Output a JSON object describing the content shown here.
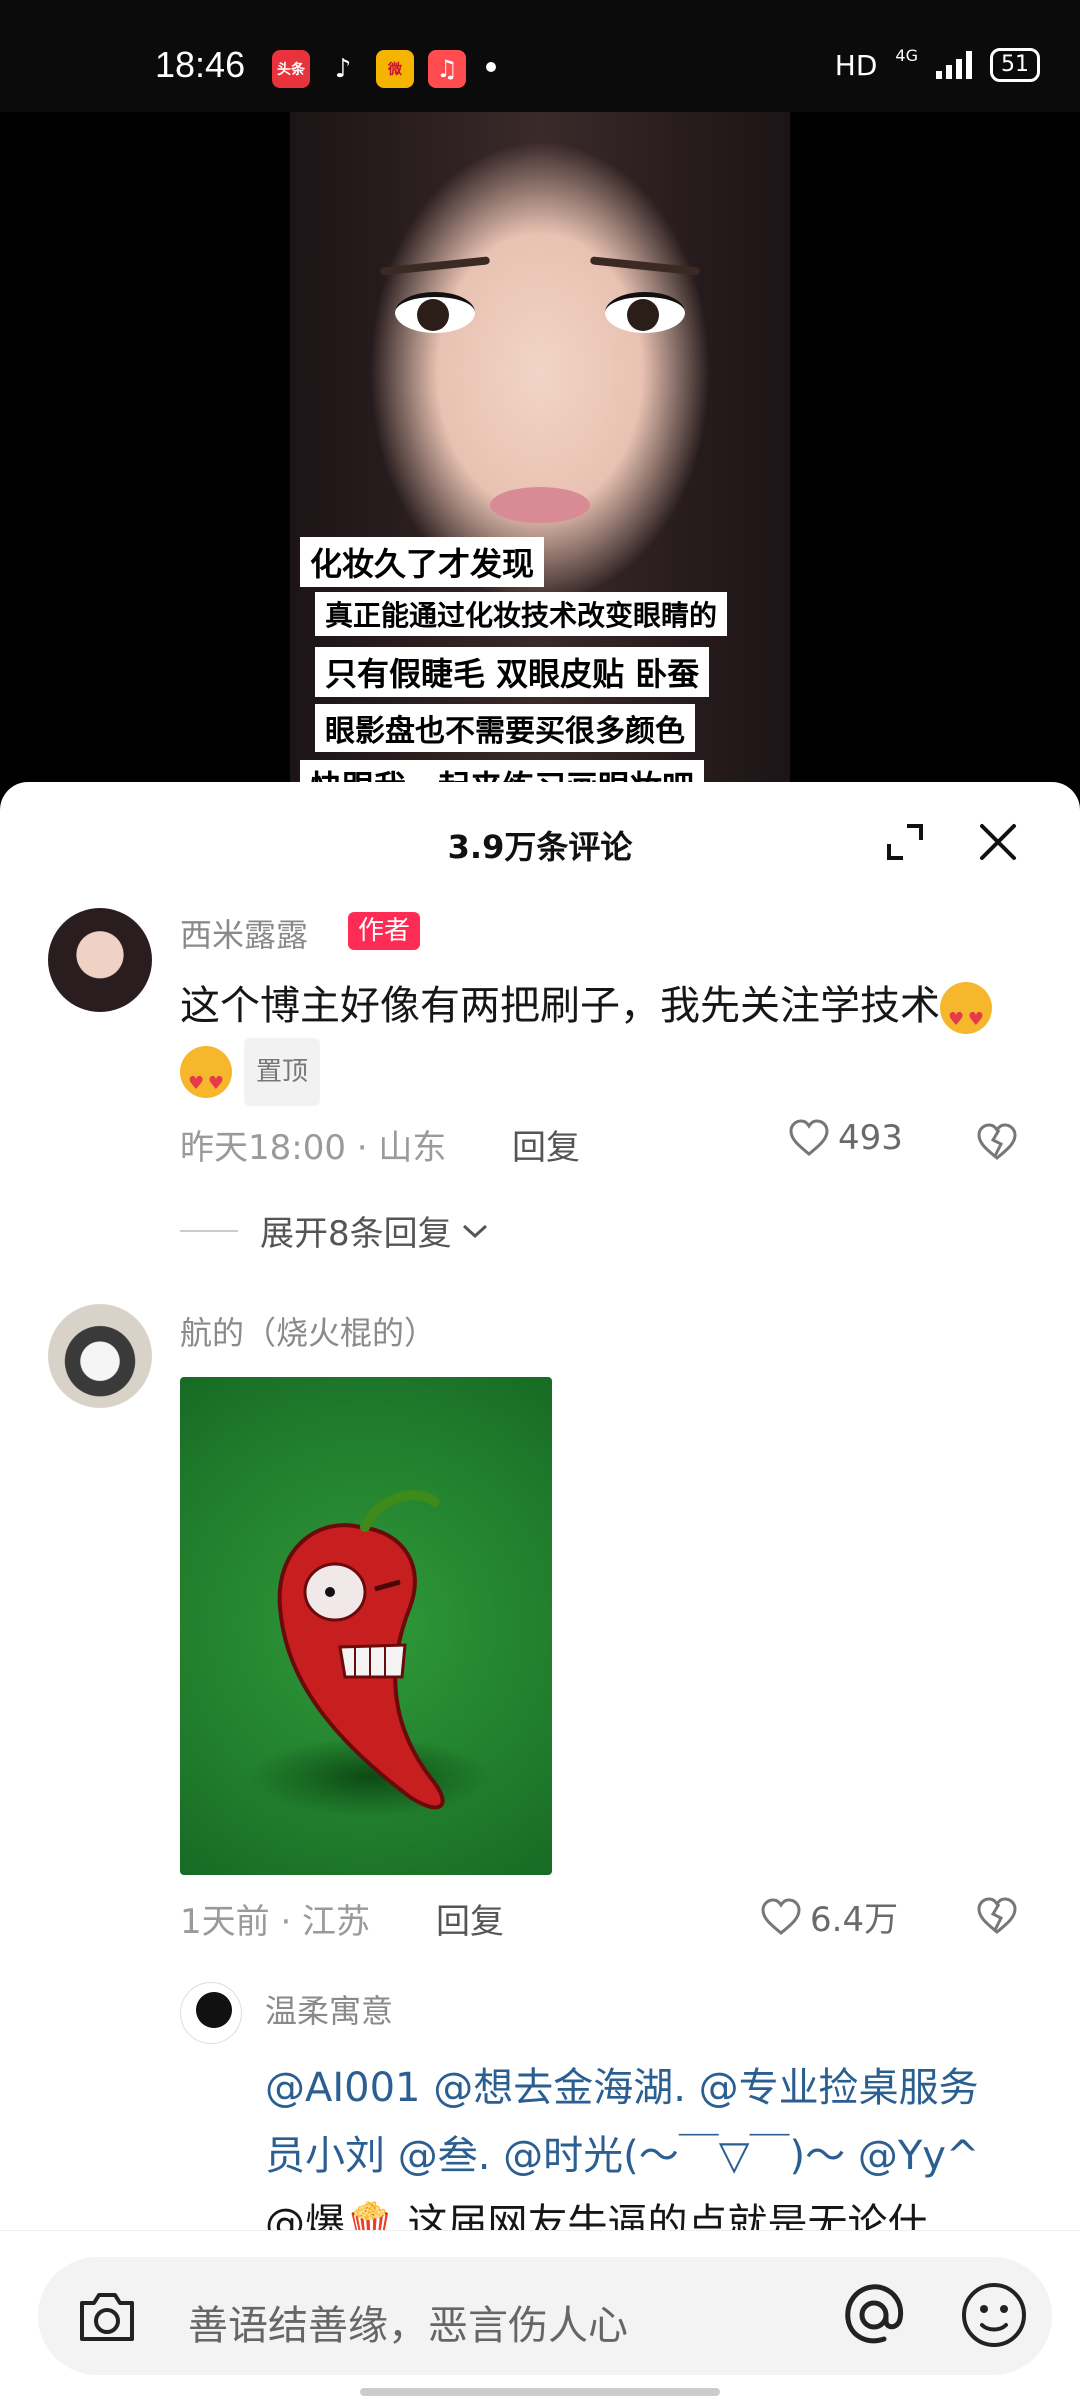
{
  "status_bar": {
    "time": "18:46",
    "apps": [
      {
        "icon": "toutiao-icon",
        "label": "头条",
        "color": "#e8323c"
      },
      {
        "icon": "tiktok-icon",
        "label": "♪",
        "color": "#0b0b0b"
      },
      {
        "icon": "weibo-icon",
        "label": "微",
        "color": "#f5b400"
      },
      {
        "icon": "music-icon",
        "label": "♫",
        "color": "#ff4d4f"
      }
    ],
    "hd": "HD",
    "network": "4G",
    "battery": "51"
  },
  "video": {
    "captions": [
      "化妆久了才发现",
      "真正能通过化妆技术改变眼睛的",
      "只有假睫毛 双眼皮贴 卧蚕",
      "眼影盘也不需要买很多颜色",
      "快跟我一起来练习画眼妆吧"
    ]
  },
  "sheet": {
    "title": "3.9万条评论"
  },
  "comments": [
    {
      "username": "西米露露",
      "tag": "作者",
      "text": "这个博主好像有两把刷子，我先关注学技术",
      "pin": "置顶",
      "time_location": "昨天18:00 · 山东",
      "reply": "回复",
      "likes": "493",
      "expand": "展开8条回复"
    },
    {
      "username": "航的（烧火棍的）",
      "time_location": "1天前 · 江苏",
      "reply": "回复",
      "likes": "6.4万"
    }
  ],
  "sub_reply": {
    "username": "温柔寓意",
    "line1": "@AI001 @想去金海湖. @专业捡桌服务",
    "line2": "员小刘 @叁. @时光(〜￣▽￣)〜 @Yy^",
    "line3": "@爆🍿 这届网友牛逼的点就是无论什"
  },
  "input": {
    "placeholder": "善语结善缘，恶言伤人心"
  },
  "colors": {
    "author_tag": "#fe2c55",
    "mention": "#2b5f91"
  }
}
